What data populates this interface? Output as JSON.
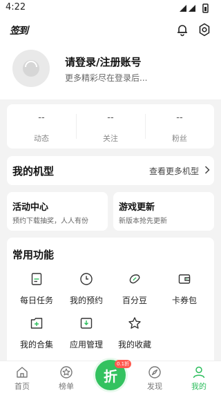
{
  "status": {
    "time": "4:22"
  },
  "header": {
    "signin_label": "签到"
  },
  "profile": {
    "title": "请登录/注册账号",
    "subtitle": "更多精彩尽在登录后..."
  },
  "stats": [
    {
      "value": "--",
      "label": "动态"
    },
    {
      "value": "--",
      "label": "关注"
    },
    {
      "value": "--",
      "label": "粉丝"
    }
  ],
  "device": {
    "title": "我的机型",
    "more": "查看更多机型"
  },
  "cards": {
    "activity": {
      "title": "活动中心",
      "sub": "预约下载抽奖，人人有份"
    },
    "update": {
      "title": "游戏更新",
      "sub": "新版本抢先更新"
    }
  },
  "funcs": {
    "title": "常用功能",
    "items": [
      {
        "label": "每日任务",
        "icon": "task-icon"
      },
      {
        "label": "我的预约",
        "icon": "clock-icon"
      },
      {
        "label": "百分豆",
        "icon": "bean-icon"
      },
      {
        "label": "卡券包",
        "icon": "wallet-icon"
      },
      {
        "label": "我的合集",
        "icon": "collection-add-icon"
      },
      {
        "label": "应用管理",
        "icon": "download-box-icon"
      },
      {
        "label": "我的收藏",
        "icon": "star-icon"
      }
    ]
  },
  "nav": {
    "items": [
      {
        "label": "首页",
        "icon": "home-icon"
      },
      {
        "label": "榜单",
        "icon": "medal-icon"
      },
      {
        "label": "发现",
        "icon": "compass-icon"
      },
      {
        "label": "我的",
        "icon": "user-icon"
      }
    ],
    "discount": "折",
    "badge": "0.1折",
    "active_color": "#2bbd5b"
  }
}
